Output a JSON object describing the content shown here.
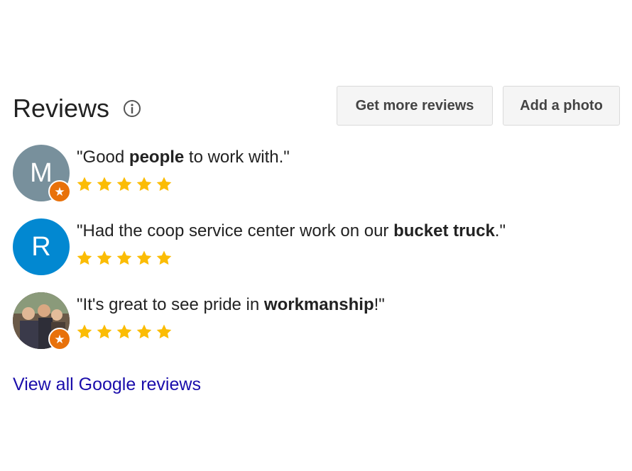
{
  "header": {
    "title": "Reviews",
    "info_icon": "info-icon",
    "get_more_label": "Get more reviews",
    "add_photo_label": "Add a photo"
  },
  "colors": {
    "star": "#fbbc04",
    "badge": "#e8710a",
    "link": "#1a0dab",
    "avatar_m": "#78909c",
    "avatar_r": "#0288d1"
  },
  "reviews": [
    {
      "avatar_letter": "M",
      "has_badge": true,
      "quote_open": "\"Good ",
      "quote_bold": "people",
      "quote_close": " to work with.\"",
      "rating": 5
    },
    {
      "avatar_letter": "R",
      "has_badge": false,
      "quote_open": "\"Had the coop service center work on our ",
      "quote_bold": "bucket truck",
      "quote_close": ".\"",
      "rating": 5
    },
    {
      "avatar_letter": "",
      "avatar_type": "photo",
      "has_badge": true,
      "quote_open": "\"It's great to see pride in ",
      "quote_bold": "workmanship",
      "quote_close": "!\"",
      "rating": 5
    }
  ],
  "footer": {
    "view_all_label": "View all Google reviews"
  }
}
